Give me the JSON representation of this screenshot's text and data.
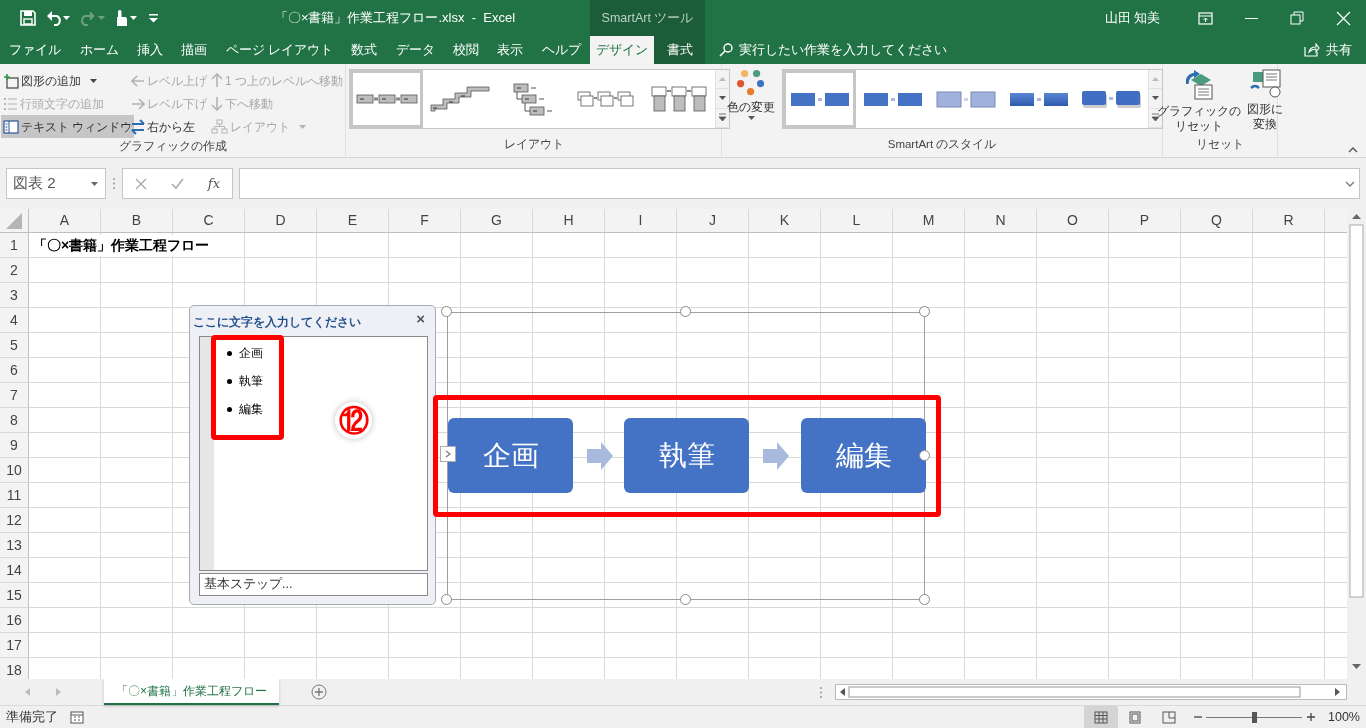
{
  "window": {
    "title": "「〇×書籍」作業工程フロー.xlsx  -  Excel",
    "contextual_group": "SmartArt ツール",
    "user": "山田 知美"
  },
  "quick_access": [
    {
      "kind": "save",
      "disabled": false
    },
    {
      "kind": "undo",
      "disabled": false
    },
    {
      "kind": "redo",
      "disabled": true
    },
    {
      "kind": "touch",
      "disabled": false
    },
    {
      "kind": "customize",
      "disabled": false
    }
  ],
  "tabs": [
    {
      "label": "ファイル",
      "selected": false,
      "contextual": false
    },
    {
      "label": "ホーム",
      "selected": false,
      "contextual": false
    },
    {
      "label": "挿入",
      "selected": false,
      "contextual": false
    },
    {
      "label": "描画",
      "selected": false,
      "contextual": false
    },
    {
      "label": "ページ レイアウト",
      "selected": false,
      "contextual": false
    },
    {
      "label": "数式",
      "selected": false,
      "contextual": false
    },
    {
      "label": "データ",
      "selected": false,
      "contextual": false
    },
    {
      "label": "校閲",
      "selected": false,
      "contextual": false
    },
    {
      "label": "表示",
      "selected": false,
      "contextual": false
    },
    {
      "label": "ヘルプ",
      "selected": false,
      "contextual": false
    },
    {
      "label": "デザイン",
      "selected": true,
      "contextual": true
    },
    {
      "label": "書式",
      "selected": false,
      "contextual": true
    }
  ],
  "tell_me": {
    "placeholder": "実行したい作業を入力してください"
  },
  "share": "共有",
  "ribbon": {
    "create_graphic": {
      "label": "グラフィックの作成",
      "commands": [
        {
          "kind": "add_shape",
          "label": "図形の追加",
          "disabled": false,
          "pressed": false,
          "dropdown": true
        },
        {
          "kind": "promote",
          "label": "レベル上げ",
          "disabled": true,
          "pressed": false,
          "dropdown": false
        },
        {
          "kind": "move_up",
          "label": "1 つ上のレベルへ移動",
          "disabled": true,
          "pressed": false,
          "dropdown": false
        },
        {
          "kind": "add_bullet",
          "label": "行頭文字の追加",
          "disabled": true,
          "pressed": false,
          "dropdown": false
        },
        {
          "kind": "demote",
          "label": "レベル下げ",
          "disabled": true,
          "pressed": false,
          "dropdown": false
        },
        {
          "kind": "move_down",
          "label": "下へ移動",
          "disabled": true,
          "pressed": false,
          "dropdown": false
        },
        {
          "kind": "text_pane",
          "label": "テキスト ウィンドウ",
          "disabled": false,
          "pressed": true,
          "dropdown": false
        },
        {
          "kind": "right_to_left",
          "label": "右から左",
          "disabled": false,
          "pressed": false,
          "dropdown": false
        },
        {
          "kind": "layout",
          "label": "レイアウト",
          "disabled": true,
          "pressed": false,
          "dropdown": true
        }
      ]
    },
    "layouts": {
      "label": "レイアウト",
      "items": [
        {
          "kind": "basic_process",
          "selected": true
        },
        {
          "kind": "step_up",
          "selected": false
        },
        {
          "kind": "hierarchy_steps",
          "selected": false
        },
        {
          "kind": "labeled_process",
          "selected": false
        },
        {
          "kind": "list_process",
          "selected": false
        }
      ]
    },
    "color_button": {
      "label": "色の変更"
    },
    "styles": {
      "label": "SmartArt のスタイル",
      "items": [
        {
          "kind": "flat",
          "selected": true
        },
        {
          "kind": "flat",
          "selected": false
        },
        {
          "kind": "pale",
          "selected": false
        },
        {
          "kind": "gradient",
          "selected": false
        },
        {
          "kind": "shadow",
          "selected": false
        }
      ]
    },
    "reset": {
      "label": "リセット",
      "buttons": [
        {
          "kind": "reset_graphic",
          "lines": [
            "グラフィックの",
            "リセット"
          ]
        },
        {
          "kind": "convert",
          "lines": [
            "図形に",
            "変換"
          ]
        }
      ]
    }
  },
  "formula_bar": {
    "name_box": "図表 2",
    "function_label": "fx"
  },
  "sheet": {
    "columns": [
      "A",
      "B",
      "C",
      "D",
      "E",
      "F",
      "G",
      "H",
      "I",
      "J",
      "K",
      "L",
      "M",
      "N",
      "O",
      "P",
      "Q",
      "R"
    ],
    "rows": [
      "1",
      "2",
      "3",
      "4",
      "5",
      "6",
      "7",
      "8",
      "9",
      "10",
      "11",
      "12",
      "13",
      "14",
      "15",
      "16",
      "17",
      "18"
    ],
    "a1": "「〇×書籍」作業工程フロー"
  },
  "text_pane": {
    "title": "ここに文字を入力してください",
    "close": "×",
    "bullets": [
      "企画",
      "執筆",
      "編集"
    ],
    "footer": "基本ステップ..."
  },
  "smartart": {
    "shapes": [
      "企画",
      "執筆",
      "編集"
    ]
  },
  "annotation": {
    "badge": "⑫"
  },
  "sheet_tabs": [
    {
      "label": "「〇×書籍」作業工程フロー",
      "selected": true
    }
  ],
  "status_bar": {
    "text": "準備完了",
    "views": [
      {
        "kind": "normal",
        "selected": true
      },
      {
        "kind": "page_layout",
        "selected": false
      },
      {
        "kind": "page_break",
        "selected": false
      }
    ],
    "zoom": {
      "level": 0.5,
      "reading": "100%"
    }
  }
}
